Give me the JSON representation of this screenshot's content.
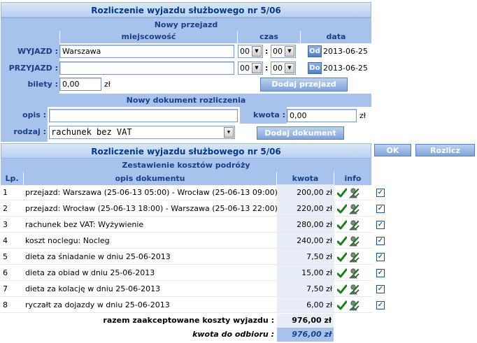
{
  "top_title": "Rozliczenie wyjazdu służbowego nr 5/06",
  "new_trip": {
    "header": "Nowy przejazd",
    "col_place": "miejscowość",
    "col_time": "czas",
    "col_date": "data",
    "departure": {
      "label": "WYJAZD :",
      "place": "Warszawa",
      "hour": "00",
      "minute": "00",
      "date_btn": "Od",
      "date": "2013-06-25"
    },
    "arrival": {
      "label": "PRZYJAZD :",
      "place": "",
      "hour": "00",
      "minute": "00",
      "date_btn": "Do",
      "date": "2013-06-25"
    },
    "time_sep": ":",
    "tickets_label": "bilety :",
    "tickets_value": "0,00",
    "currency": "zł",
    "add_button": "Dodaj przejazd"
  },
  "new_doc": {
    "header": "Nowy dokument rozliczenia",
    "desc_label": "opis :",
    "desc_value": "",
    "amount_label": "kwota :",
    "amount_value": "0,00",
    "currency": "zł",
    "type_label": "rodzaj :",
    "type_value": "rachunek bez VAT",
    "add_button": "Dodaj dokument"
  },
  "summary": {
    "title": "Rozliczenie wyjazdu służbowego nr 5/06",
    "ok_button": "OK",
    "settle_button": "Rozlicz",
    "subheader": "Zestawienie kosztów podróży",
    "columns": {
      "lp": "Lp.",
      "desc": "opis dokumentu",
      "amount": "kwota",
      "info": "info"
    },
    "rows": [
      {
        "lp": "1",
        "desc": "przejazd: Warszawa (25-06-13 05:00) - Wrocław (25-06-13 09:00)",
        "amount": "200,00 zł"
      },
      {
        "lp": "2",
        "desc": "przejazd: Wrocław (25-06-13 18:00) - Warszawa (25-06-13 22:00)",
        "amount": "220,00 zł"
      },
      {
        "lp": "3",
        "desc": "rachunek bez VAT: Wyżywienie",
        "amount": "280,00 zł"
      },
      {
        "lp": "4",
        "desc": "koszt noclegu: Nocleg",
        "amount": "240,00 zł"
      },
      {
        "lp": "5",
        "desc": "dieta za śniadanie w dniu 25-06-2013",
        "amount": "7,50 zł"
      },
      {
        "lp": "6",
        "desc": "dieta za obiad w dniu 25-06-2013",
        "amount": "15,00 zł"
      },
      {
        "lp": "7",
        "desc": "dieta za kolację w dniu 25-06-2013",
        "amount": "7,50 zł"
      },
      {
        "lp": "8",
        "desc": "ryczałt za dojazdy w dniu 25-06-2013",
        "amount": "6,00 zł"
      }
    ],
    "total_label": "razem zaakceptowane koszty wyjazdu :",
    "total_value": "976,00 zł",
    "payout_label": "kwota do odbioru :",
    "payout_value": "976,00 zł"
  },
  "icons": {
    "accept": "checkmark-icon",
    "edit": "edit-icon"
  },
  "colors": {
    "header_blue": "#a7c3eb",
    "header_text": "#1a3f8a",
    "check_green": "#1e7a1e"
  }
}
